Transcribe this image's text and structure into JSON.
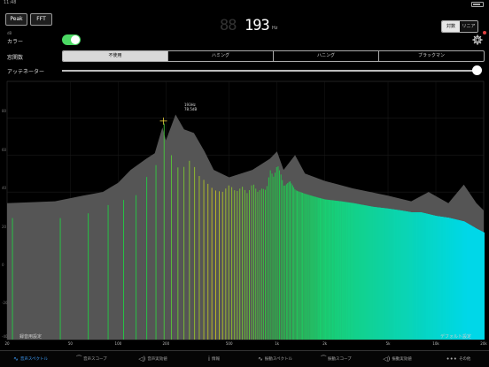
{
  "status": {
    "time": "11:48"
  },
  "toolbar": {
    "peak_label": "Peak",
    "fft_label": "FFT",
    "freq_ghost": "88",
    "freq_value": "193",
    "freq_unit": "Hz",
    "scale_log": "対数",
    "scale_linear": "リニア"
  },
  "settings": {
    "db_label": "dB",
    "color_label": "カラー",
    "color_enabled": true,
    "window_label": "窓関数",
    "window_options": [
      "不使用",
      "ハミング",
      "ハニング",
      "ブラックマン"
    ],
    "window_selected": "不使用",
    "attenuator_label": "アッテネーター",
    "attenuator_level": 1.0
  },
  "chart": {
    "y_ticks": [
      "80",
      "60",
      "40",
      "20",
      "0",
      "-20",
      "-40"
    ],
    "cursor_freq": "193Hz",
    "cursor_level": "78.5dB",
    "left_button": "録音用設定",
    "right_button": "デフォルト設定"
  },
  "chart_data": {
    "type": "bar",
    "xscale": "log",
    "xlim": [
      20,
      20000
    ],
    "ylim": [
      -40,
      100
    ],
    "x_tick_labels": [
      "20",
      "50",
      "100",
      "200",
      "500",
      "1k",
      "2k",
      "5k",
      "10k",
      "20k"
    ],
    "x_tick_values": [
      20,
      50,
      100,
      200,
      500,
      1000,
      2000,
      5000,
      10000,
      20000
    ],
    "cursor": {
      "freq": 193,
      "level": 78.5
    },
    "peak_profile": [
      [
        20,
        34
      ],
      [
        40,
        35
      ],
      [
        60,
        38
      ],
      [
        80,
        40
      ],
      [
        100,
        45
      ],
      [
        120,
        52
      ],
      [
        150,
        58
      ],
      [
        170,
        61
      ],
      [
        190,
        75
      ],
      [
        200,
        68
      ],
      [
        230,
        82
      ],
      [
        260,
        74
      ],
      [
        300,
        72
      ],
      [
        350,
        62
      ],
      [
        400,
        52
      ],
      [
        500,
        48
      ],
      [
        700,
        52
      ],
      [
        900,
        58
      ],
      [
        1000,
        62
      ],
      [
        1100,
        52
      ],
      [
        1300,
        60
      ],
      [
        1500,
        50
      ],
      [
        2000,
        46
      ],
      [
        3000,
        42
      ],
      [
        5000,
        38
      ],
      [
        7000,
        35
      ],
      [
        9000,
        40
      ],
      [
        12000,
        34
      ],
      [
        15000,
        44
      ],
      [
        18000,
        34
      ],
      [
        20000,
        30
      ]
    ],
    "spectrum_profile": [
      [
        20,
        -7
      ],
      [
        25,
        -20
      ],
      [
        30,
        -20
      ],
      [
        40,
        -20
      ],
      [
        50,
        -7
      ],
      [
        60,
        -20
      ],
      [
        70,
        -20
      ],
      [
        80,
        -20
      ],
      [
        100,
        -20
      ],
      [
        120,
        -20
      ],
      [
        150,
        -20
      ],
      [
        180,
        -20
      ],
      [
        193,
        -20
      ],
      [
        220,
        -20
      ],
      [
        260,
        -20
      ],
      [
        300,
        -20
      ],
      [
        400,
        -20
      ],
      [
        500,
        -20
      ],
      [
        700,
        -20
      ],
      [
        1000,
        -20
      ],
      [
        1200,
        -20
      ],
      [
        2000,
        -20
      ],
      [
        5000,
        -20
      ],
      [
        10000,
        -20
      ],
      [
        20000,
        -20
      ]
    ],
    "spectrum_levels": [
      [
        20,
        28
      ],
      [
        30,
        16
      ],
      [
        50,
        30
      ],
      [
        70,
        28
      ],
      [
        80,
        36
      ],
      [
        90,
        31
      ],
      [
        100,
        38
      ],
      [
        110,
        35
      ],
      [
        120,
        41
      ],
      [
        130,
        38
      ],
      [
        140,
        44
      ],
      [
        150,
        48
      ],
      [
        160,
        51
      ],
      [
        170,
        54
      ],
      [
        180,
        57
      ],
      [
        193,
        78.5
      ],
      [
        200,
        60
      ],
      [
        210,
        62
      ],
      [
        220,
        58
      ],
      [
        230,
        54
      ],
      [
        250,
        52
      ],
      [
        270,
        56
      ],
      [
        290,
        58
      ],
      [
        310,
        50
      ],
      [
        340,
        47
      ],
      [
        370,
        44
      ],
      [
        400,
        41
      ],
      [
        450,
        40
      ],
      [
        500,
        44
      ],
      [
        550,
        40
      ],
      [
        600,
        43
      ],
      [
        650,
        39
      ],
      [
        700,
        45
      ],
      [
        750,
        40
      ],
      [
        800,
        42
      ],
      [
        850,
        41
      ],
      [
        900,
        52
      ],
      [
        950,
        48
      ],
      [
        1000,
        55
      ],
      [
        1050,
        50
      ],
      [
        1100,
        43
      ],
      [
        1200,
        46
      ],
      [
        1300,
        41
      ],
      [
        1500,
        39
      ],
      [
        1800,
        37
      ],
      [
        2000,
        36
      ],
      [
        2500,
        35
      ],
      [
        3000,
        34
      ],
      [
        4000,
        32
      ],
      [
        5000,
        31
      ],
      [
        6000,
        30
      ],
      [
        7000,
        29
      ],
      [
        8000,
        29
      ],
      [
        10000,
        27
      ],
      [
        12000,
        26
      ],
      [
        15000,
        24
      ],
      [
        18000,
        20
      ],
      [
        20000,
        18
      ]
    ],
    "colors": {
      "peak_fill": "#555555",
      "spectrum_low": "#22cc44",
      "spectrum_mid": "#c8c020",
      "spectrum_high": "#00d8e8",
      "cursor": "#e8d040"
    }
  },
  "tabs": [
    {
      "label": "音声スペクトル",
      "icon": "spectrum-icon",
      "glyph": "∿",
      "active": true
    },
    {
      "label": "音声スコープ",
      "icon": "scope-icon",
      "glyph": "⁀",
      "active": false
    },
    {
      "label": "音声実効値",
      "icon": "rms-icon",
      "glyph": "◁)",
      "active": false
    },
    {
      "label": "情報",
      "icon": "info-icon",
      "glyph": "i",
      "active": false
    },
    {
      "label": "振動スペクトル",
      "icon": "vibration-spectrum-icon",
      "glyph": "∿",
      "active": false
    },
    {
      "label": "振動スコープ",
      "icon": "vibration-scope-icon",
      "glyph": "⁀",
      "active": false
    },
    {
      "label": "振動実効値",
      "icon": "vibration-rms-icon",
      "glyph": "◁)",
      "active": false
    },
    {
      "label": "その他",
      "icon": "more-icon",
      "glyph": "•••",
      "active": false
    }
  ]
}
